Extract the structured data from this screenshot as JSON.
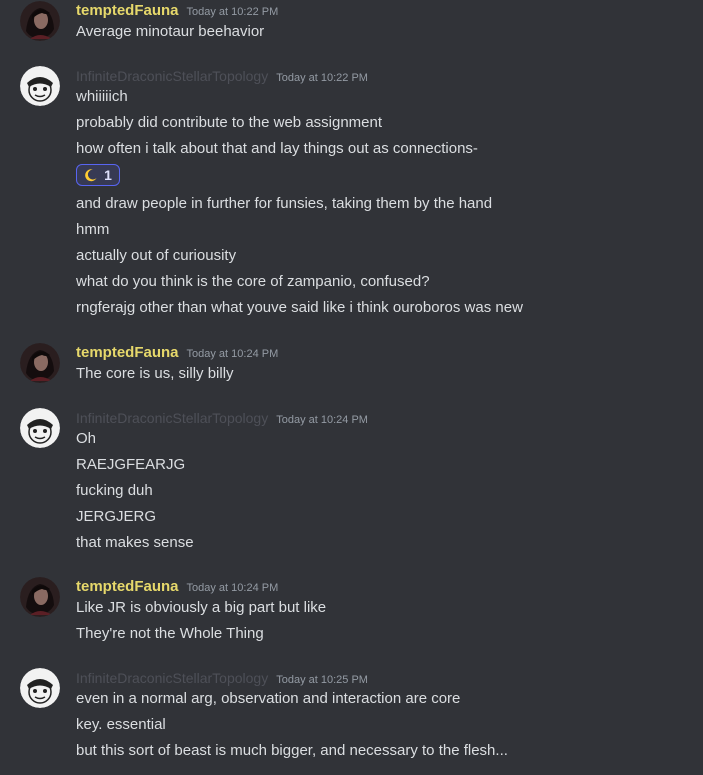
{
  "messages": [
    {
      "author": "temptedFauna",
      "timestamp": "Today at 10:22 PM",
      "lines": [
        "Average minotaur beehavior"
      ]
    },
    {
      "author": "InfiniteDraconicStellarTopology",
      "timestamp": "Today at 10:22 PM",
      "lines": [
        "whiiiiich",
        "probably did contribute to the web assignment",
        "how often i talk about that and lay things out as connections-",
        "and draw people in further for funsies, taking them by the hand",
        "hmm",
        "actually out of curiousity",
        "what do you think is the core of zampanio, confused?",
        "rngferajg other than what youve said like i think ouroboros was new"
      ],
      "reaction": {
        "emoji": "crescent-moon",
        "count": "1"
      }
    },
    {
      "author": "temptedFauna",
      "timestamp": "Today at 10:24 PM",
      "lines": [
        "The core is us, silly billy"
      ]
    },
    {
      "author": "InfiniteDraconicStellarTopology",
      "timestamp": "Today at 10:24 PM",
      "lines": [
        "Oh",
        "RAEJGFEARJG",
        "fucking duh",
        "JERGJERG",
        "that makes sense"
      ]
    },
    {
      "author": "temptedFauna",
      "timestamp": "Today at 10:24 PM",
      "lines": [
        "Like JR is obviously a big part but like",
        "They're not the Whole Thing"
      ]
    },
    {
      "author": "InfiniteDraconicStellarTopology",
      "timestamp": "Today at 10:25 PM",
      "lines": [
        "even in a normal arg, observation and interaction are core",
        "key. essential",
        "but this sort of beast is much bigger, and necessary to the flesh..."
      ]
    }
  ],
  "colors": {
    "background": "#313338",
    "fauna_name": "#e6d86b",
    "idst_name": "#4e5058",
    "text": "#dbdee1",
    "timestamp": "#949ba4",
    "reaction_border": "#5865f2"
  }
}
